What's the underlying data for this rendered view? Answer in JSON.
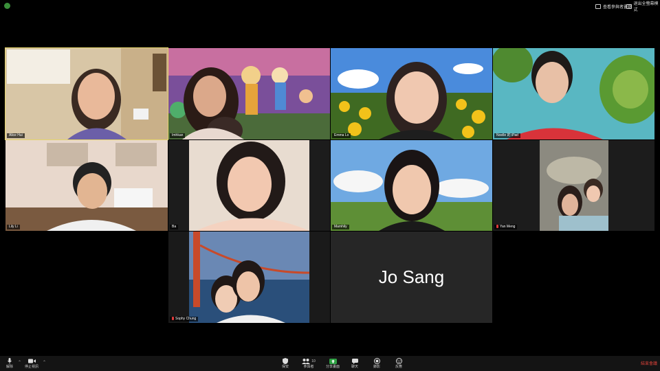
{
  "top_bar": {
    "view_options_label": "查看參與者畫廊",
    "exit_fullscreen_label": "退出全螢幕模式"
  },
  "participants": [
    {
      "name": "Alice Hui"
    },
    {
      "name": "Imhkan"
    },
    {
      "name": "Emma Lo"
    },
    {
      "name": "Noelle 的 iPad"
    },
    {
      "name": "Lily Li"
    },
    {
      "name": "Ba"
    },
    {
      "name": "Mamhily"
    },
    {
      "name": "Yan Meng"
    },
    {
      "name": "Sophy Chung"
    },
    {
      "name": "Jo Sang"
    }
  ],
  "toolbar": {
    "unmute_label": "解除",
    "video_label": "停止視訊",
    "security_label": "保安",
    "participants_label": "參與者",
    "participants_count": "10",
    "share_label": "分享畫面",
    "chat_label": "聊天",
    "record_label": "錄影",
    "reactions_label": "反應",
    "end_label": "結束會議"
  },
  "colors": {
    "active_speaker_border": "#e6d56a",
    "share_green": "#2ea043",
    "end_red": "#e0433a",
    "toolbar_bg": "#141414"
  }
}
